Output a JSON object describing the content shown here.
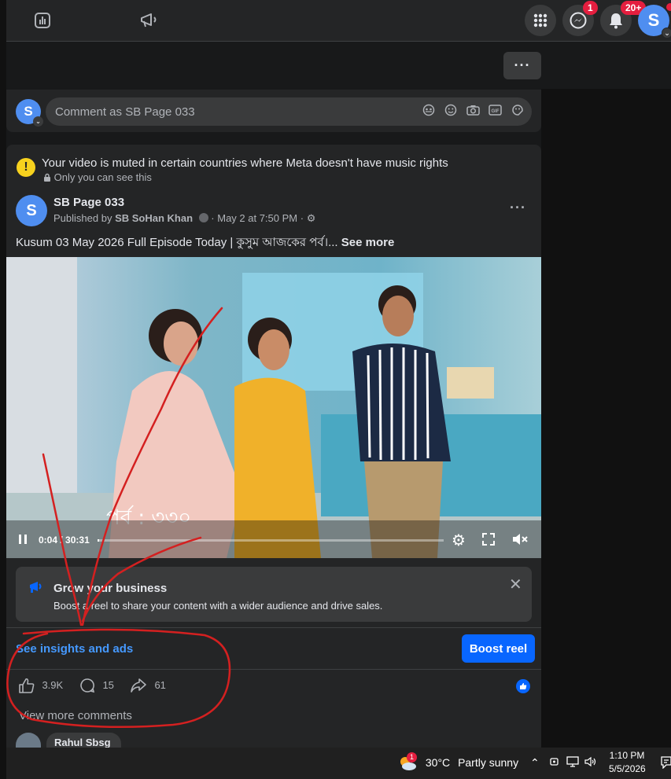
{
  "topbar": {
    "messenger_badge": "1",
    "notifications_badge": "20+",
    "profile_initial": "S"
  },
  "comment_box": {
    "avatar_initial": "S",
    "placeholder": "Comment as SB Page 033"
  },
  "post": {
    "warning_title": "Your video is muted in certain countries where Meta doesn't have music rights",
    "warning_sub": "Only you can see this",
    "page_name": "SB Page 033",
    "avatar_initial": "S",
    "published_prefix": "Published by",
    "publisher": "SB SoHan Khan",
    "date": "May 2 at 7:50 PM",
    "caption": "Kusum 03 May 2026 Full Episode Today | কুসুম আজকের পর্ব।...",
    "see_more": "See more",
    "video": {
      "overlay_text": "পর্ব : ৩৩০",
      "current_time": "0:04",
      "duration": "30:31",
      "progress": 0.002
    },
    "boost_banner": {
      "title": "Grow your business",
      "description": "Boost a reel to share your content with a wider audience and drive sales."
    },
    "insights_link": "See insights and ads",
    "boost_button": "Boost reel",
    "stats": {
      "likes": "3.9K",
      "comments": "15",
      "shares": "61"
    },
    "view_more_comments": "View more comments",
    "first_commenter": "Rahul Sbsg"
  },
  "taskbar": {
    "weather_badge": "1",
    "temperature": "30°C",
    "weather": "Partly sunny",
    "time": "1:10 PM",
    "date": "5/5/2026"
  },
  "colors": {
    "accent": "#0866ff",
    "link": "#4599ff",
    "annotation": "#d42020"
  }
}
